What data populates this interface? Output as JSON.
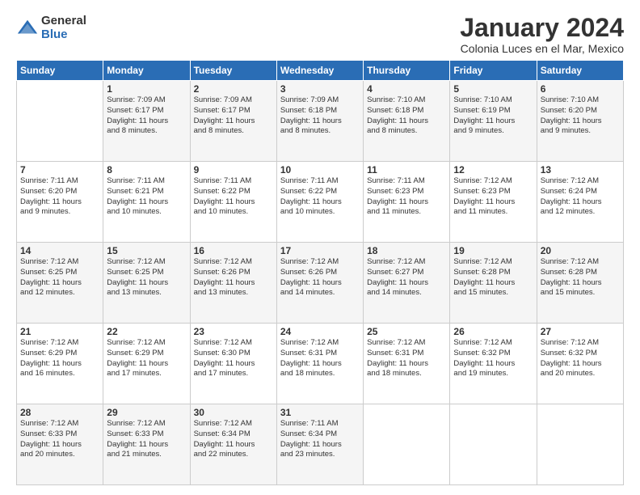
{
  "logo": {
    "general": "General",
    "blue": "Blue"
  },
  "header": {
    "month": "January 2024",
    "location": "Colonia Luces en el Mar, Mexico"
  },
  "weekdays": [
    "Sunday",
    "Monday",
    "Tuesday",
    "Wednesday",
    "Thursday",
    "Friday",
    "Saturday"
  ],
  "weeks": [
    [
      {
        "day": "",
        "info": ""
      },
      {
        "day": "1",
        "info": "Sunrise: 7:09 AM\nSunset: 6:17 PM\nDaylight: 11 hours\nand 8 minutes."
      },
      {
        "day": "2",
        "info": "Sunrise: 7:09 AM\nSunset: 6:17 PM\nDaylight: 11 hours\nand 8 minutes."
      },
      {
        "day": "3",
        "info": "Sunrise: 7:09 AM\nSunset: 6:18 PM\nDaylight: 11 hours\nand 8 minutes."
      },
      {
        "day": "4",
        "info": "Sunrise: 7:10 AM\nSunset: 6:18 PM\nDaylight: 11 hours\nand 8 minutes."
      },
      {
        "day": "5",
        "info": "Sunrise: 7:10 AM\nSunset: 6:19 PM\nDaylight: 11 hours\nand 9 minutes."
      },
      {
        "day": "6",
        "info": "Sunrise: 7:10 AM\nSunset: 6:20 PM\nDaylight: 11 hours\nand 9 minutes."
      }
    ],
    [
      {
        "day": "7",
        "info": "Sunrise: 7:11 AM\nSunset: 6:20 PM\nDaylight: 11 hours\nand 9 minutes."
      },
      {
        "day": "8",
        "info": "Sunrise: 7:11 AM\nSunset: 6:21 PM\nDaylight: 11 hours\nand 10 minutes."
      },
      {
        "day": "9",
        "info": "Sunrise: 7:11 AM\nSunset: 6:22 PM\nDaylight: 11 hours\nand 10 minutes."
      },
      {
        "day": "10",
        "info": "Sunrise: 7:11 AM\nSunset: 6:22 PM\nDaylight: 11 hours\nand 10 minutes."
      },
      {
        "day": "11",
        "info": "Sunrise: 7:11 AM\nSunset: 6:23 PM\nDaylight: 11 hours\nand 11 minutes."
      },
      {
        "day": "12",
        "info": "Sunrise: 7:12 AM\nSunset: 6:23 PM\nDaylight: 11 hours\nand 11 minutes."
      },
      {
        "day": "13",
        "info": "Sunrise: 7:12 AM\nSunset: 6:24 PM\nDaylight: 11 hours\nand 12 minutes."
      }
    ],
    [
      {
        "day": "14",
        "info": "Sunrise: 7:12 AM\nSunset: 6:25 PM\nDaylight: 11 hours\nand 12 minutes."
      },
      {
        "day": "15",
        "info": "Sunrise: 7:12 AM\nSunset: 6:25 PM\nDaylight: 11 hours\nand 13 minutes."
      },
      {
        "day": "16",
        "info": "Sunrise: 7:12 AM\nSunset: 6:26 PM\nDaylight: 11 hours\nand 13 minutes."
      },
      {
        "day": "17",
        "info": "Sunrise: 7:12 AM\nSunset: 6:26 PM\nDaylight: 11 hours\nand 14 minutes."
      },
      {
        "day": "18",
        "info": "Sunrise: 7:12 AM\nSunset: 6:27 PM\nDaylight: 11 hours\nand 14 minutes."
      },
      {
        "day": "19",
        "info": "Sunrise: 7:12 AM\nSunset: 6:28 PM\nDaylight: 11 hours\nand 15 minutes."
      },
      {
        "day": "20",
        "info": "Sunrise: 7:12 AM\nSunset: 6:28 PM\nDaylight: 11 hours\nand 15 minutes."
      }
    ],
    [
      {
        "day": "21",
        "info": "Sunrise: 7:12 AM\nSunset: 6:29 PM\nDaylight: 11 hours\nand 16 minutes."
      },
      {
        "day": "22",
        "info": "Sunrise: 7:12 AM\nSunset: 6:29 PM\nDaylight: 11 hours\nand 17 minutes."
      },
      {
        "day": "23",
        "info": "Sunrise: 7:12 AM\nSunset: 6:30 PM\nDaylight: 11 hours\nand 17 minutes."
      },
      {
        "day": "24",
        "info": "Sunrise: 7:12 AM\nSunset: 6:31 PM\nDaylight: 11 hours\nand 18 minutes."
      },
      {
        "day": "25",
        "info": "Sunrise: 7:12 AM\nSunset: 6:31 PM\nDaylight: 11 hours\nand 18 minutes."
      },
      {
        "day": "26",
        "info": "Sunrise: 7:12 AM\nSunset: 6:32 PM\nDaylight: 11 hours\nand 19 minutes."
      },
      {
        "day": "27",
        "info": "Sunrise: 7:12 AM\nSunset: 6:32 PM\nDaylight: 11 hours\nand 20 minutes."
      }
    ],
    [
      {
        "day": "28",
        "info": "Sunrise: 7:12 AM\nSunset: 6:33 PM\nDaylight: 11 hours\nand 20 minutes."
      },
      {
        "day": "29",
        "info": "Sunrise: 7:12 AM\nSunset: 6:33 PM\nDaylight: 11 hours\nand 21 minutes."
      },
      {
        "day": "30",
        "info": "Sunrise: 7:12 AM\nSunset: 6:34 PM\nDaylight: 11 hours\nand 22 minutes."
      },
      {
        "day": "31",
        "info": "Sunrise: 7:11 AM\nSunset: 6:34 PM\nDaylight: 11 hours\nand 23 minutes."
      },
      {
        "day": "",
        "info": ""
      },
      {
        "day": "",
        "info": ""
      },
      {
        "day": "",
        "info": ""
      }
    ]
  ]
}
